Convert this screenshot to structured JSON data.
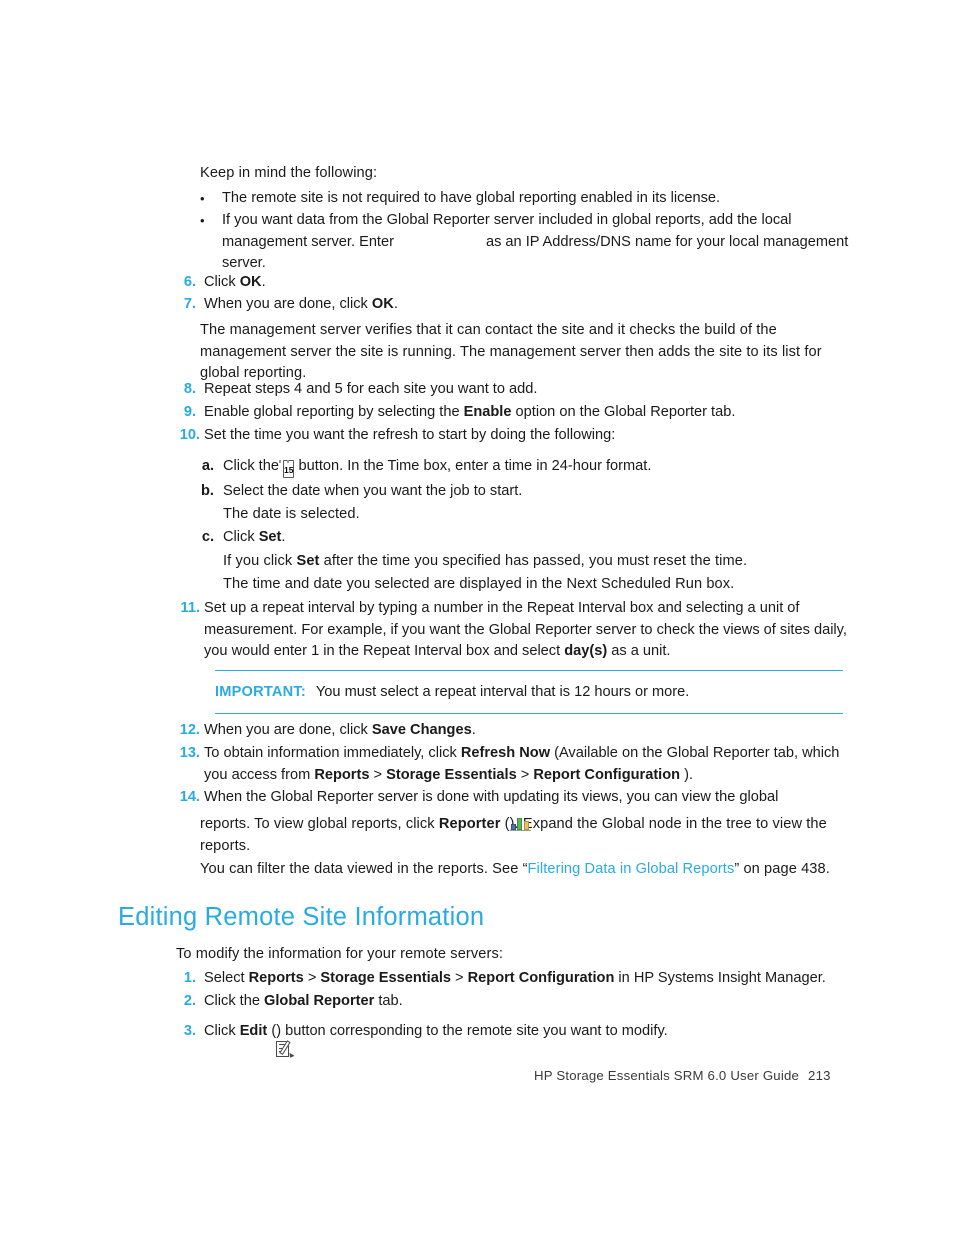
{
  "document": {
    "intro": "Keep in mind the following:",
    "bullets": [
      {
        "text": "The remote site is not required to have global reporting enabled in its license."
      },
      {
        "pre": "If you want data from the Global Reporter server included in global reports, add the local management server. Enter",
        "post": "as an IP Address/DNS name for your local management server."
      }
    ],
    "steps": [
      {
        "num": "6.",
        "pre": "Click ",
        "bold": "OK",
        "post": "."
      },
      {
        "num": "7.",
        "pre": "When you are done, click ",
        "bold": "OK",
        "post": ".",
        "continuation": "The management server verifies that it can contact the site and it checks the build of the management server the site is running. The management server then adds the site to its list for global reporting."
      },
      {
        "num": "8.",
        "pre": "Repeat steps 4 and 5 for each site you want to add."
      },
      {
        "num": "9.",
        "pre": "Enable global reporting by selecting the ",
        "bold": "Enable",
        "post": " option on the Global Reporter tab."
      },
      {
        "num": "10.",
        "pre": "Set the time you want the refresh to start by doing the following:"
      }
    ],
    "substeps": [
      {
        "letter": "a.",
        "pre": "Click the ",
        "icon": "calendar-15-icon",
        "post": " button. In the Time box, enter a time in 24-hour format."
      },
      {
        "letter": "b.",
        "pre": "Select the date when you want the job to start.",
        "continuation": "The date is selected."
      },
      {
        "letter": "c.",
        "pre": "Click ",
        "bold": "Set",
        "post": ".",
        "continuation1_pre": "If you click ",
        "continuation1_bold": "Set",
        "continuation1_post": " after the time you specified has passed, you must reset the time.",
        "continuation2": "The time and date you selected are displayed in the Next Scheduled Run box."
      }
    ],
    "step11": {
      "num": "11.",
      "pre": "Set up a repeat interval by typing a number in the Repeat Interval box and selecting a unit of measurement. For example, if you want the Global Reporter server to check the views of sites daily, you would enter 1 in the Repeat Interval box and select ",
      "bold": "day(s)",
      "post": " as a unit."
    },
    "note": {
      "label": "IMPORTANT:",
      "text": "You must select a repeat interval that is 12 hours or more."
    },
    "step12": {
      "num": "12.",
      "pre": "When you are done, click ",
      "bold": "Save Changes",
      "post": "."
    },
    "step13": {
      "num": "13.",
      "pre": "To obtain information immediately, click ",
      "bold1": "Refresh Now",
      "mid1": " (Available on the Global Reporter tab, which you access from ",
      "bold2": "Reports",
      "sep1": " > ",
      "bold3": "Storage Essentials",
      "sep2": " > ",
      "bold4": "Report Configuration",
      "post": " )."
    },
    "step14": {
      "num": "14.",
      "line1": "When the Global Reporter server is done with updating its views, you can view the global",
      "line2_pre": "reports. To view global reports, click ",
      "line2_bold": "Reporter",
      "icon": "bar-chart-icon",
      "line2_post": "). Expand the Global node in the tree to view the reports.",
      "filter_pre": "You can filter the data viewed in the reports. See “",
      "filter_link": "Filtering Data in Global Reports",
      "filter_post": "” on page 438."
    },
    "heading": "Editing Remote Site Information",
    "section_intro": "To modify the information for your remote servers:",
    "edit_steps": [
      {
        "num": "1.",
        "pre": "Select ",
        "bold1": "Reports",
        "sep1": " > ",
        "bold2": "Storage Essentials",
        "sep2": " > ",
        "bold3": "Report Configuration",
        "post": " in HP Systems Insight Manager."
      },
      {
        "num": "2.",
        "pre": "Click the ",
        "bold1": "Global Reporter",
        "post": " tab."
      },
      {
        "num": "3.",
        "pre": "Click ",
        "bold1": "Edit",
        "mid": " (",
        "icon": "edit-pencil-icon",
        "post": ") button corresponding to the remote site you want to modify."
      }
    ],
    "footer": {
      "guide": "HP Storage Essentials SRM 6.0 User Guide",
      "page": "213"
    },
    "colors": {
      "accent": "#29abe2",
      "text": "#1a1a1a"
    }
  }
}
